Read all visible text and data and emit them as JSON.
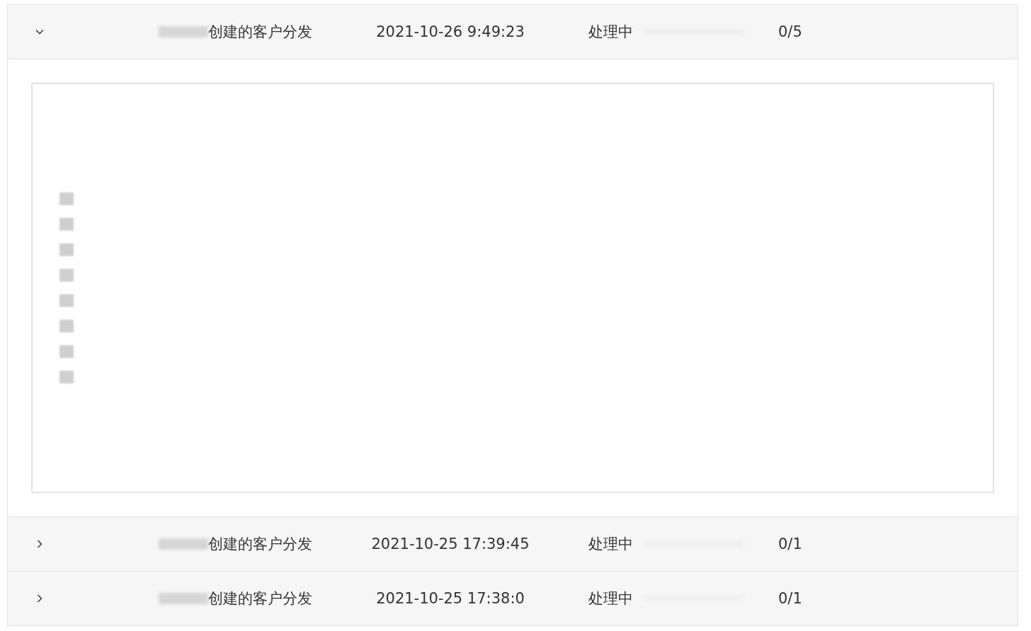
{
  "rows": [
    {
      "expanded": true,
      "name": "创建的客户分发",
      "time": "2021-10-26 9:49:23",
      "status": "处理中",
      "progress": "0/5"
    },
    {
      "expanded": false,
      "name": "创建的客户分发",
      "time": "2021-10-25 17:39:45",
      "status": "处理中",
      "progress": "0/1"
    },
    {
      "expanded": false,
      "name": "创建的客户分发",
      "time": "2021-10-25 17:38:0",
      "status": "处理中",
      "progress": "0/1"
    }
  ]
}
